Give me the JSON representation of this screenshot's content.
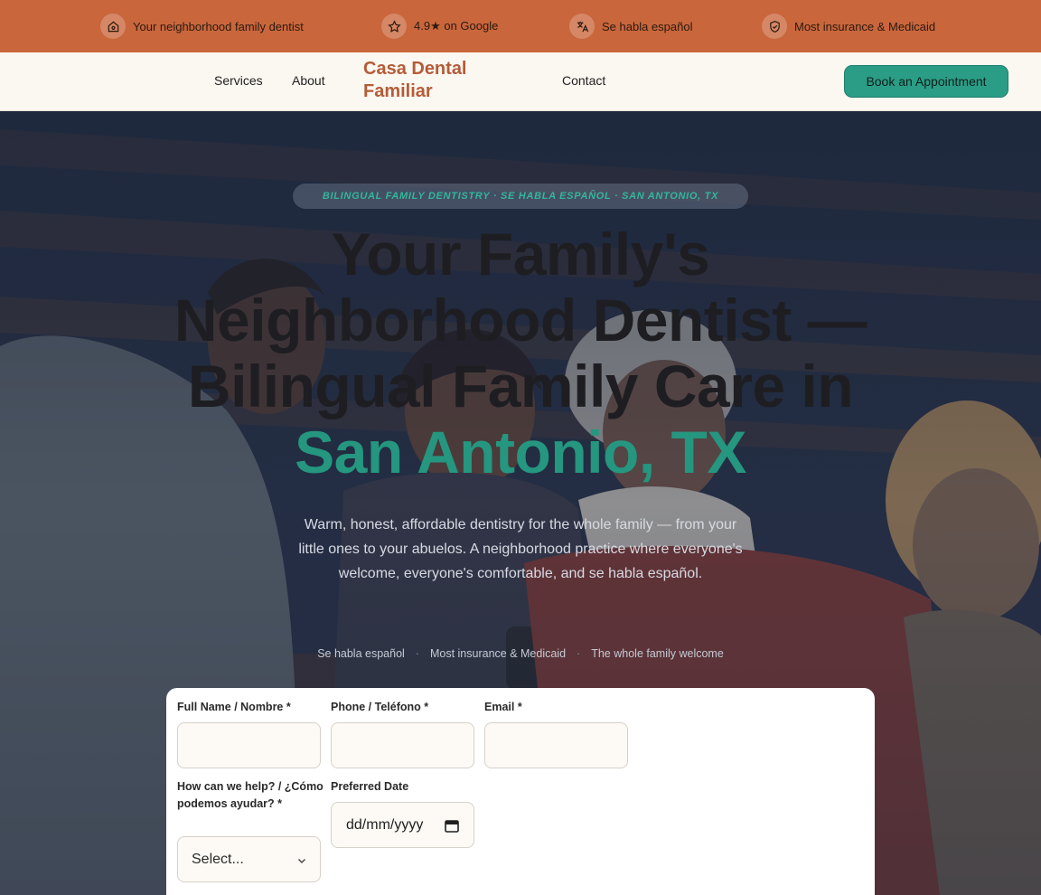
{
  "topbar": {
    "items": [
      {
        "icon": "home-heart-icon",
        "text": "Your neighborhood family dentist"
      },
      {
        "icon": "star-icon",
        "text": "4.9★ on Google"
      },
      {
        "icon": "translate-icon",
        "text": "Se habla español"
      },
      {
        "icon": "shield-check-icon",
        "text": "Most insurance & Medicaid"
      }
    ]
  },
  "nav": {
    "links": [
      "Services",
      "About",
      "Contact"
    ],
    "logo_line1": "Casa Dental",
    "logo_line2": "Familiar",
    "cta": "Book an Appointment"
  },
  "hero": {
    "badge": "BILINGUAL FAMILY DENTISTRY · SE HABLA ESPAÑOL · SAN ANTONIO, TX",
    "headline_main": "Your Family's Neighborhood Dentist — Bilingual Family Care in",
    "headline_accent": "San Antonio, TX",
    "subtext": "Warm, honest, affordable dentistry for the whole family — from your little ones to your abuelos. A neighborhood practice where everyone's welcome, everyone's comfortable, and se habla español.",
    "features": [
      "Se habla español",
      "Most insurance & Medicaid",
      "The whole family welcome"
    ]
  },
  "form": {
    "name_label": "Full Name / Nombre *",
    "phone_label": "Phone / Teléfono *",
    "email_label": "Email *",
    "help_label": "How can we help? / ¿Cómo podemos ayudar? *",
    "date_label": "Preferred Date",
    "date_placeholder": "dd/mm/yyyy",
    "select_value": "Select..."
  },
  "colors": {
    "topbar": "#c9663c",
    "brand": "#b45c38",
    "accent": "#2b9d86",
    "nav_bg": "#fbf7f1"
  }
}
